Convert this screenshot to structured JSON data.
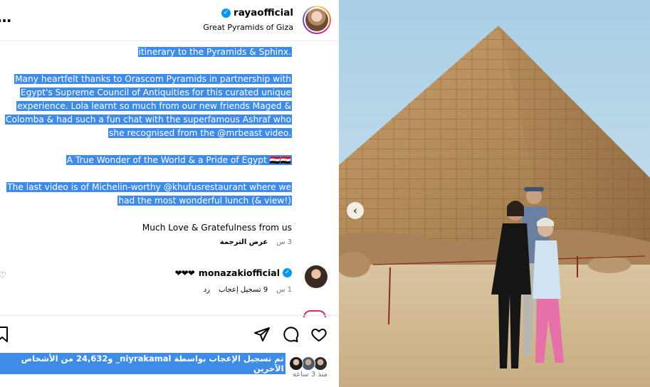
{
  "post": {
    "username": "rayaofficial",
    "location": "Great Pyramids of Giza",
    "more_icon": "more-dots-icon",
    "caption_lines": [
      "itinerary to the Pyramids & Sphinx.",
      "",
      "Many heartfelt thanks to Orascom Pyramids in partnership with",
      "Egypt's Supreme Council of Antiquities for this curated unique",
      "experience. Lola learnt so much from our new friends Maged &",
      "Colomba & had such a fun chat with the superfamous Ashraf who",
      "she recognised from the @mrbeast video.",
      "",
      "A True Wonder of the World & a Pride of Egypt 🇪🇬🇪🇬",
      "",
      "The last video is of Michelin-worthy @khufusrestaurant where we",
      "had the most wonderful lunch (& view!)",
      "",
      "Much Love & Gratefulness from us"
    ],
    "caption_time": "3 س",
    "see_translation": "عرض الترجمة"
  },
  "comment": {
    "username": "monazakiofficial",
    "text": "❤❤❤",
    "time": "1 س",
    "likes": "9 تسجيل إعجاب",
    "reply": "رد"
  },
  "likes_summary": {
    "text": "تم تسجيل الإعجاب بواسطة niyrakamal_ و24,632 من الأشخاص الآخرين",
    "time_ago": "منذ 3 ساعة"
  },
  "icons": {
    "like": "heart-icon",
    "comment": "comment-icon",
    "share": "share-icon",
    "save": "bookmark-icon",
    "prev": "chevron-left-icon"
  },
  "colors": {
    "selection": "#3f8ce8",
    "verified": "#0095f6",
    "muted": "#737373"
  }
}
